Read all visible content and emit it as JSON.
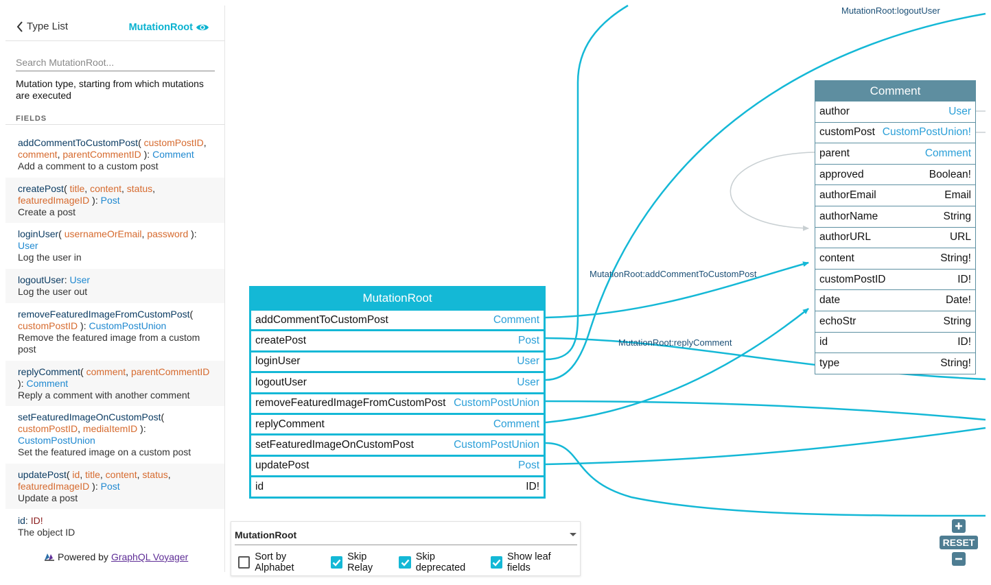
{
  "sidebar": {
    "back_label": "Type List",
    "current_type": "MutationRoot",
    "search_placeholder": "Search MutationRoot...",
    "description": "Mutation type, starting from which mutations are executed",
    "fields_heading": "FIELDS",
    "fields": [
      {
        "name": "addCommentToCustomPost",
        "args": [
          "customPostID",
          "comment",
          "parentCommentID"
        ],
        "type": "Comment",
        "description": "Add a comment to a custom post"
      },
      {
        "name": "createPost",
        "args": [
          "title",
          "content",
          "status",
          "featuredImageID"
        ],
        "type": "Post",
        "description": "Create a post"
      },
      {
        "name": "loginUser",
        "args": [
          "usernameOrEmail",
          "password"
        ],
        "type": "User",
        "description": "Log the user in"
      },
      {
        "name": "logoutUser",
        "args": [],
        "type": "User",
        "description": "Log the user out"
      },
      {
        "name": "removeFeaturedImageFromCustomPost",
        "args": [
          "customPostID"
        ],
        "type": "CustomPostUnion",
        "description": "Remove the featured image from a custom post"
      },
      {
        "name": "replyComment",
        "args": [
          "comment",
          "parentCommentID"
        ],
        "type": "Comment",
        "description": "Reply a comment with another comment"
      },
      {
        "name": "setFeaturedImageOnCustomPost",
        "args": [
          "customPostID",
          "mediaItemID"
        ],
        "type": "CustomPostUnion",
        "description": "Set the featured image on a custom post"
      },
      {
        "name": "updatePost",
        "args": [
          "id",
          "title",
          "content",
          "status",
          "featuredImageID"
        ],
        "type": "Post",
        "description": "Update a post"
      },
      {
        "name": "id",
        "args": [],
        "type": "ID!",
        "description": "The object ID"
      }
    ],
    "powered_prefix": "Powered by",
    "powered_link": "GraphQL Voyager"
  },
  "graph": {
    "edge_labels": {
      "logout": "MutationRoot:logoutUser",
      "add_comment": "MutationRoot:addCommentToCustomPost",
      "reply": "MutationRoot:replyComment"
    },
    "colors": {
      "mutation_accent": "#14b8d6",
      "comment_header": "#5e8ea0",
      "edge": "#14b8d6",
      "link_type": "#2a9fd8"
    },
    "mutation_node": {
      "title": "MutationRoot",
      "rows": [
        {
          "name": "addCommentToCustomPost",
          "type": "Comment",
          "link": true
        },
        {
          "name": "createPost",
          "type": "Post",
          "link": true
        },
        {
          "name": "loginUser",
          "type": "User",
          "link": true
        },
        {
          "name": "logoutUser",
          "type": "User",
          "link": true
        },
        {
          "name": "removeFeaturedImageFromCustomPost",
          "type": "CustomPostUnion",
          "link": true
        },
        {
          "name": "replyComment",
          "type": "Comment",
          "link": true
        },
        {
          "name": "setFeaturedImageOnCustomPost",
          "type": "CustomPostUnion",
          "link": true
        },
        {
          "name": "updatePost",
          "type": "Post",
          "link": true
        },
        {
          "name": "id",
          "type": "ID!",
          "link": false
        }
      ]
    },
    "comment_node": {
      "title": "Comment",
      "rows": [
        {
          "name": "author",
          "type": "User",
          "link": true
        },
        {
          "name": "customPost",
          "type": "CustomPostUnion!",
          "link": true
        },
        {
          "name": "parent",
          "type": "Comment",
          "link": true
        },
        {
          "name": "approved",
          "type": "Boolean!",
          "link": false
        },
        {
          "name": "authorEmail",
          "type": "Email",
          "link": false
        },
        {
          "name": "authorName",
          "type": "String",
          "link": false
        },
        {
          "name": "authorURL",
          "type": "URL",
          "link": false
        },
        {
          "name": "content",
          "type": "String!",
          "link": false
        },
        {
          "name": "customPostID",
          "type": "ID!",
          "link": false
        },
        {
          "name": "date",
          "type": "Date!",
          "link": false
        },
        {
          "name": "echoStr",
          "type": "String",
          "link": false
        },
        {
          "name": "id",
          "type": "ID!",
          "link": false
        },
        {
          "name": "type",
          "type": "String!",
          "link": false
        }
      ]
    }
  },
  "settings": {
    "root_type": "MutationRoot",
    "options": [
      {
        "label": "Sort by Alphabet",
        "checked": false
      },
      {
        "label": "Skip Relay",
        "checked": true
      },
      {
        "label": "Skip deprecated",
        "checked": true
      },
      {
        "label": "Show leaf fields",
        "checked": true
      }
    ]
  },
  "zoom": {
    "reset_label": "RESET"
  }
}
